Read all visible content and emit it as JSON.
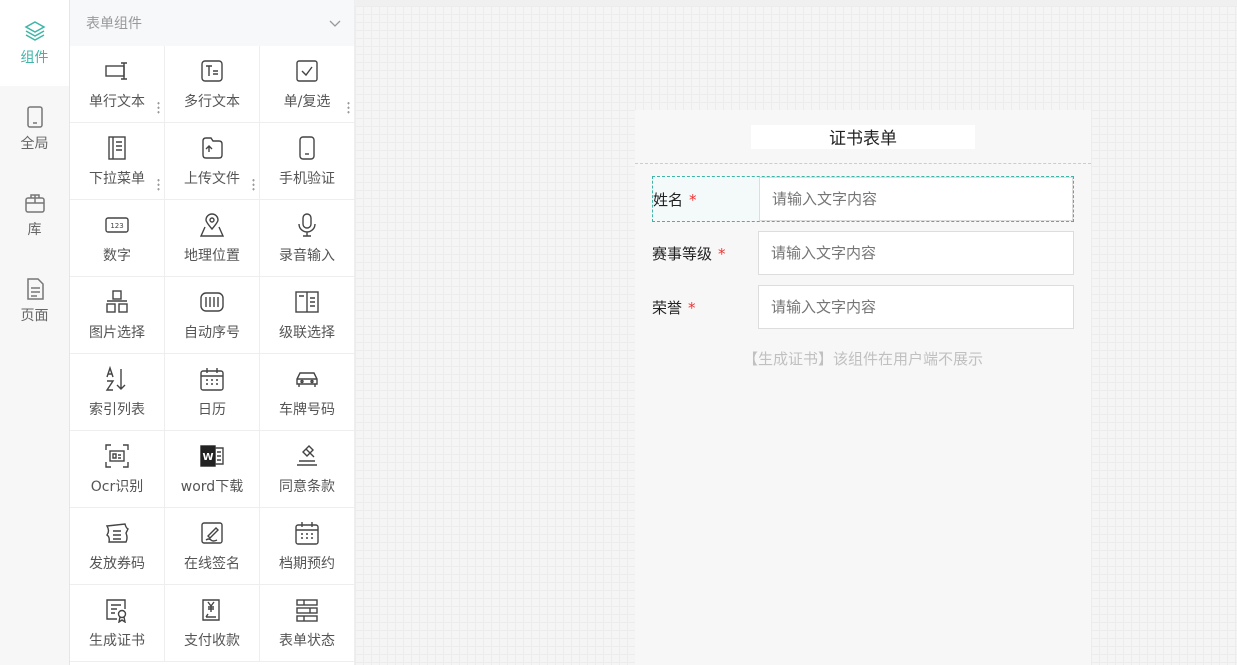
{
  "rail": {
    "items": [
      {
        "label": "组件",
        "icon": "layers-icon",
        "active": true
      },
      {
        "label": "全局",
        "icon": "tablet-icon",
        "active": false
      },
      {
        "label": "库",
        "icon": "box-icon",
        "active": false
      },
      {
        "label": "页面",
        "icon": "page-icon",
        "active": false
      }
    ]
  },
  "panel": {
    "header": "表单组件",
    "components": [
      {
        "label": "单行文本",
        "icon": "single-line-text-icon"
      },
      {
        "label": "多行文本",
        "icon": "multi-line-text-icon"
      },
      {
        "label": "单/复选",
        "icon": "checkbox-icon"
      },
      {
        "label": "下拉菜单",
        "icon": "dropdown-icon"
      },
      {
        "label": "上传文件",
        "icon": "upload-file-icon"
      },
      {
        "label": "手机验证",
        "icon": "phone-icon"
      },
      {
        "label": "数字",
        "icon": "number-icon"
      },
      {
        "label": "地理位置",
        "icon": "map-pin-icon"
      },
      {
        "label": "录音输入",
        "icon": "microphone-icon"
      },
      {
        "label": "图片选择",
        "icon": "image-grid-icon"
      },
      {
        "label": "自动序号",
        "icon": "barcode-icon"
      },
      {
        "label": "级联选择",
        "icon": "cascade-icon"
      },
      {
        "label": "索引列表",
        "icon": "sort-az-icon"
      },
      {
        "label": "日历",
        "icon": "calendar-icon"
      },
      {
        "label": "车牌号码",
        "icon": "car-icon"
      },
      {
        "label": "Ocr识别",
        "icon": "scan-icon"
      },
      {
        "label": "word下载",
        "icon": "word-icon"
      },
      {
        "label": "同意条款",
        "icon": "gavel-icon"
      },
      {
        "label": "发放券码",
        "icon": "coupon-icon"
      },
      {
        "label": "在线签名",
        "icon": "signature-icon"
      },
      {
        "label": "档期预约",
        "icon": "schedule-icon"
      },
      {
        "label": "生成证书",
        "icon": "certificate-icon"
      },
      {
        "label": "支付收款",
        "icon": "payment-icon"
      },
      {
        "label": "表单状态",
        "icon": "status-icon"
      }
    ]
  },
  "form": {
    "title": "证书表单",
    "fields": [
      {
        "label": "姓名",
        "required": "*",
        "placeholder": "请输入文字内容"
      },
      {
        "label": "赛事等级",
        "required": "*",
        "placeholder": "请输入文字内容"
      },
      {
        "label": "荣誉",
        "required": "*",
        "placeholder": "请输入文字内容"
      }
    ],
    "note": "【生成证书】该组件在用户端不展示"
  },
  "colors": {
    "accent": "#3fb5a8",
    "required": "#e33333"
  }
}
